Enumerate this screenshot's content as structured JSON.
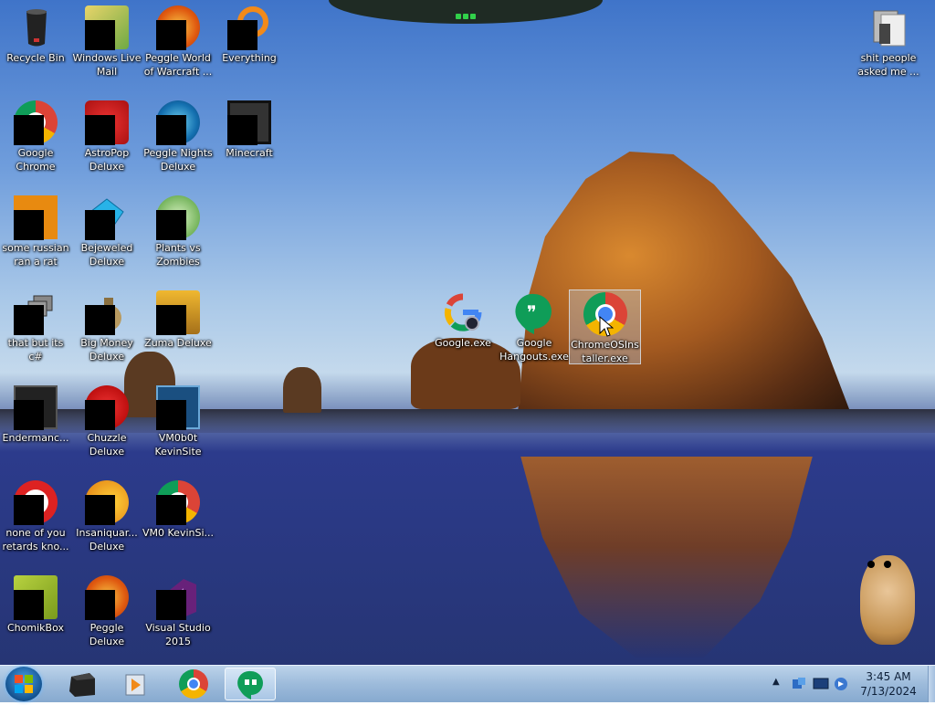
{
  "desktop": {
    "icons": [
      {
        "label": "Recycle Bin"
      },
      {
        "label": "Windows Live Mail"
      },
      {
        "label": "Peggle World of Warcraft ..."
      },
      {
        "label": "Everything"
      },
      {
        "label": "Google Chrome"
      },
      {
        "label": "AstroPop Deluxe"
      },
      {
        "label": "Peggle Nights Deluxe"
      },
      {
        "label": "Minecraft"
      },
      {
        "label": "some russian ran a rat"
      },
      {
        "label": "Bejeweled Deluxe"
      },
      {
        "label": "Plants vs Zombies"
      },
      {
        "label": "that but its c#"
      },
      {
        "label": "Big Money Deluxe"
      },
      {
        "label": "Zuma Deluxe"
      },
      {
        "label": "Endermanc..."
      },
      {
        "label": "Chuzzle Deluxe"
      },
      {
        "label": "VM0b0t KevinSite"
      },
      {
        "label": "none of you retards kno..."
      },
      {
        "label": "Insaniquar... Deluxe"
      },
      {
        "label": "VM0 KevinSi..."
      },
      {
        "label": "ChomikBox"
      },
      {
        "label": "Peggle Deluxe"
      },
      {
        "label": "Visual Studio 2015"
      },
      {
        "label": "Google.exe"
      },
      {
        "label": "Google Hangouts.exe"
      },
      {
        "label": "ChromeOSInstaller.exe"
      },
      {
        "label": "shit people asked me ..."
      }
    ]
  },
  "taskbar": {
    "pinned": [
      {
        "name": "start-button",
        "icon": "windows-logo-icon"
      },
      {
        "name": "black-box-app",
        "icon": "box-icon"
      },
      {
        "name": "media-player",
        "icon": "media-player-icon"
      },
      {
        "name": "chrome",
        "icon": "chrome-icon"
      },
      {
        "name": "hangouts",
        "icon": "hangouts-icon",
        "active": true
      }
    ],
    "tray": {
      "time": "3:45 AM",
      "date": "7/13/2024"
    }
  },
  "colors": {
    "taskbar": "#9dbbdb",
    "selection": "#b4d2f0",
    "hangouts_green": "#0f9d58"
  }
}
